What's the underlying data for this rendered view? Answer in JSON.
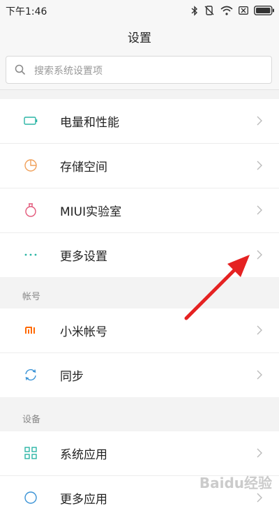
{
  "status_bar": {
    "time": "下午1:46"
  },
  "header": {
    "title": "设置"
  },
  "search": {
    "placeholder": "搜索系统设置项"
  },
  "group_top": {
    "items": [
      {
        "label": "电量和性能",
        "icon": "battery-icon"
      },
      {
        "label": "存储空间",
        "icon": "storage-pie-icon"
      },
      {
        "label": "MIUI实验室",
        "icon": "flask-icon"
      },
      {
        "label": "更多设置",
        "icon": "more-dots-icon"
      }
    ]
  },
  "section_account": {
    "title": "帐号",
    "items": [
      {
        "label": "小米帐号",
        "icon": "mi-logo-icon"
      },
      {
        "label": "同步",
        "icon": "sync-icon"
      }
    ]
  },
  "section_device": {
    "title": "设备",
    "items": [
      {
        "label": "系统应用",
        "icon": "grid-apps-icon"
      },
      {
        "label": "更多应用",
        "icon": "apps-circle-icon"
      }
    ]
  },
  "colors": {
    "accent_teal": "#2bb5a5",
    "accent_orange": "#f0a05a",
    "accent_pink": "#e2587a",
    "mi_orange": "#ff6a00",
    "annotation_red": "#e52222"
  },
  "watermark": "Baidu经验"
}
